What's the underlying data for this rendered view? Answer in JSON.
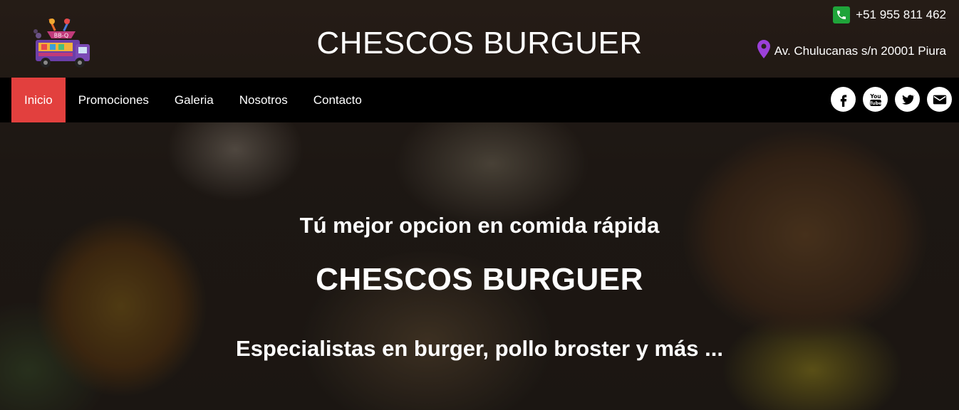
{
  "header": {
    "title": "CHESCOS BURGUER",
    "logo_icon": "food-truck-bbq-logo",
    "logo_text": "BB-Q",
    "phone": "+51 955 811 462",
    "address": "Av. Chulucanas s/n 20001 Piura",
    "phone_icon_color": "#1fa43a",
    "pin_icon_color": "#9b40d9"
  },
  "nav": {
    "items": [
      {
        "label": "Inicio",
        "active": true
      },
      {
        "label": "Promociones",
        "active": false
      },
      {
        "label": "Galeria",
        "active": false
      },
      {
        "label": "Nosotros",
        "active": false
      },
      {
        "label": "Contacto",
        "active": false
      }
    ],
    "active_color": "#e2403e",
    "background": "#000000"
  },
  "social": [
    {
      "icon": "facebook-icon"
    },
    {
      "icon": "youtube-icon",
      "text": "You Tube"
    },
    {
      "icon": "twitter-icon"
    },
    {
      "icon": "email-icon"
    }
  ],
  "hero": {
    "tagline": "Tú mejor opcion en comida rápida",
    "title": "CHESCOS BURGUER",
    "subtitle": "Especialistas en burger, pollo broster y más ..."
  }
}
